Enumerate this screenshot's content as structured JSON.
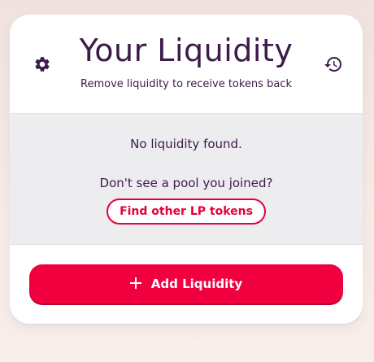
{
  "header": {
    "title": "Your Liquidity",
    "subtitle": "Remove liquidity to receive tokens back",
    "settings_icon": "gear-icon",
    "history_icon": "history-icon"
  },
  "liquidity": {
    "empty_message": "No liquidity found.",
    "pool_prompt": "Don't see a pool you joined?",
    "find_button_label": "Find other LP tokens"
  },
  "actions": {
    "add_button_label": "Add Liquidity",
    "add_icon": "plus-icon"
  },
  "colors": {
    "accent": "#f0003f",
    "text_primary": "#3d1a4a",
    "panel_bg": "#ededf0"
  }
}
